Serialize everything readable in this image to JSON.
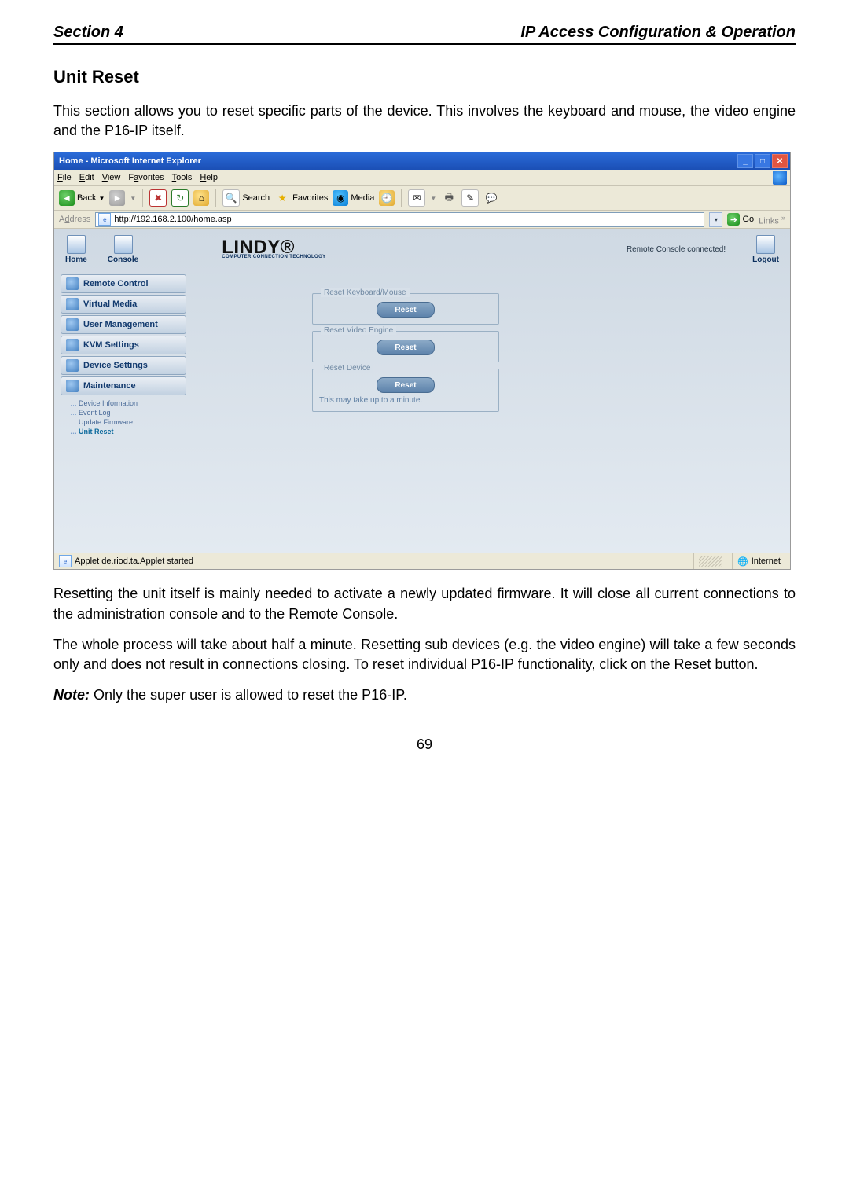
{
  "header": {
    "left": "Section 4",
    "right": "IP Access Configuration & Operation"
  },
  "doc": {
    "title": "Unit Reset",
    "p1": "This section allows you to reset specific parts of the device. This involves the keyboard and mouse, the video engine and the P16-IP itself.",
    "p2": "Resetting the unit itself is mainly needed to activate a newly updated firmware. It will close all current connections to the administration console and to the Remote Console.",
    "p3": "The whole process will take about half a minute. Resetting sub devices (e.g. the video engine) will take a few seconds only and does not result in connections closing. To reset individual P16-IP functionality, click on the Reset button.",
    "note_label": "Note:",
    "note_text": " Only the super user is allowed to reset the P16-IP.",
    "pagenum": "69"
  },
  "ie": {
    "title": "Home - Microsoft Internet Explorer",
    "menus": {
      "file": "File",
      "edit": "Edit",
      "view": "View",
      "favorites": "Favorites",
      "tools": "Tools",
      "help": "Help"
    },
    "toolbar": {
      "back": "Back",
      "search": "Search",
      "favorites": "Favorites",
      "media": "Media"
    },
    "address_label": "Address",
    "url": "http://192.168.2.100/home.asp",
    "go": "Go",
    "links": "Links",
    "branding": {
      "home": "Home",
      "console": "Console",
      "logo": "LINDY®",
      "logo_sub": "COMPUTER CONNECTION TECHNOLOGY",
      "status": "Remote Console connected!",
      "logout": "Logout"
    },
    "sidebar": {
      "remote_control": "Remote Control",
      "virtual_media": "Virtual Media",
      "user_mgmt": "User Management",
      "kvm": "KVM Settings",
      "device_settings": "Device Settings",
      "maintenance": "Maintenance",
      "subs": {
        "dev_info": "Device Information",
        "event_log": "Event Log",
        "update_fw": "Update Firmware",
        "unit_reset": "Unit Reset"
      }
    },
    "panels": {
      "kb_mouse": "Reset Keyboard/Mouse",
      "video": "Reset Video Engine",
      "device": "Reset Device",
      "device_sub": "This may take up to a minute.",
      "reset_btn": "Reset"
    },
    "statusbar": {
      "left": "Applet de.riod.ta.Applet started",
      "zone": "Internet"
    }
  }
}
